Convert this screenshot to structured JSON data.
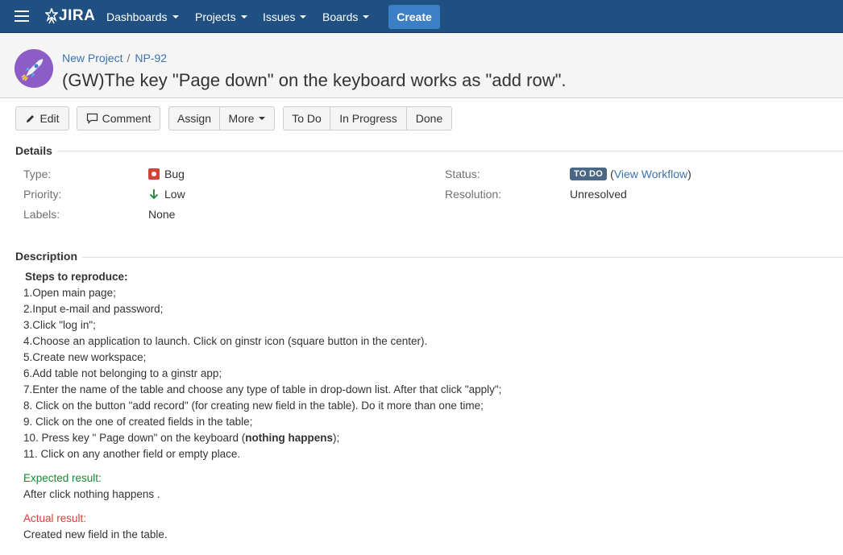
{
  "nav": {
    "logo_text": "JIRA",
    "items": [
      {
        "label": "Dashboards"
      },
      {
        "label": "Projects"
      },
      {
        "label": "Issues"
      },
      {
        "label": "Boards"
      }
    ],
    "create_label": "Create"
  },
  "issue": {
    "project": "New Project",
    "key": "NP-92",
    "title": "(GW)The key \"Page down\" on the keyboard works as \"add row\"."
  },
  "toolbar": {
    "edit": "Edit",
    "comment": "Comment",
    "assign": "Assign",
    "more": "More",
    "todo": "To Do",
    "in_progress": "In Progress",
    "done": "Done"
  },
  "details": {
    "heading": "Details",
    "type_label": "Type:",
    "type_value": "Bug",
    "priority_label": "Priority:",
    "priority_value": "Low",
    "labels_label": "Labels:",
    "labels_value": "None",
    "status_label": "Status:",
    "status_value": "TO DO",
    "status_open": "(",
    "view_workflow": "View Workflow",
    "status_close": ")",
    "resolution_label": "Resolution:",
    "resolution_value": "Unresolved"
  },
  "description": {
    "heading": "Description",
    "steps_heading": "Steps to reproduce:",
    "steps": [
      "1.Open main page;",
      "2.Input e-mail and password;",
      "3.Click \"log in\";",
      "4.Choose an application to launch. Click on ginstr icon (square button in the center).",
      "5.Create new workspace;",
      "6.Add table not belonging to a ginstr app;",
      "7.Enter the name of the table and choose any type of table in drop-down list. After that click \"apply\";",
      "8. Click on the button \"add record\" (for creating new field in the table). Do it more than one time;",
      "9. Click on the one of created fields in the table;"
    ],
    "step10_prefix": "10. Press key \" Page down\" on the keyboard (",
    "step10_bold": "nothing happens",
    "step10_suffix": ");",
    "step11": "11. Click on any another field or empty place.",
    "expected_label": "Expected result:",
    "expected_text": "After click nothing happens .",
    "actual_label": "Actual result:",
    "actual_text": "Created new field in the table."
  },
  "colors": {
    "nav_bg": "#205081",
    "create_bg": "#3b7fc4",
    "link": "#3b73af",
    "status_lozenge": "#4a6785",
    "bug_icon": "#d04437",
    "priority_low": "#14892c"
  }
}
